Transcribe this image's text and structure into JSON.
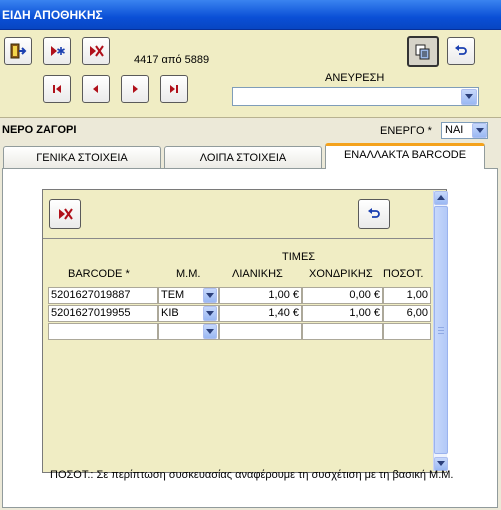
{
  "window": {
    "title": "ΕΙΔΗ ΑΠΟΘΗΚΗΣ"
  },
  "toolbar": {
    "record_position": "4417 από 5889",
    "search_label": "ΑΝΕΥΡΕΣΗ",
    "search_value": ""
  },
  "product": {
    "name": "ΝΕΡΟ ΖΑΓΟΡΙ",
    "active_label": "ΕΝΕΡΓΟ *",
    "active_value": "ΝΑΙ"
  },
  "tabs": [
    {
      "label": "ΓΕΝΙΚΑ ΣΤΟΙΧΕΙΑ",
      "active": false
    },
    {
      "label": "ΛΟΙΠΑ ΣΤΟΙΧΕΙΑ",
      "active": false
    },
    {
      "label": "ΕΝΑΛΛΑΚΤΑ BARCODE",
      "active": true
    }
  ],
  "grid": {
    "prices_group": "ΤΙΜΕΣ",
    "columns": {
      "barcode": "BARCODE *",
      "unit": "Μ.Μ.",
      "retail": "ΛΙΑΝΙΚΗΣ",
      "wholesale": "ΧΟΝΔΡΙΚΗΣ",
      "qty": "ΠΟΣΟΤ."
    },
    "rows": [
      {
        "barcode": "5201627019887",
        "unit": "TEM",
        "retail": "1,00 €",
        "wholesale": "0,00 €",
        "qty": "1,00"
      },
      {
        "barcode": "5201627019955",
        "unit": "ΚΙΒ",
        "retail": "1,40 €",
        "wholesale": "1,00 €",
        "qty": "6,00"
      }
    ]
  },
  "footnote": "ΠΟΣΟΤ.: Σε περίπτωση συσκευασίας αναφέρουμε τη συσχέτιση με τη βασική Μ.Μ.",
  "colors": {
    "title_blue": "#0a4fd6",
    "panel": "#F0EDC4",
    "nav_red": "#b0101a",
    "tab_accent": "#f4a21c"
  },
  "icons": [
    "exit-icon",
    "new-record-icon",
    "delete-record-icon",
    "first-record-icon",
    "previous-record-icon",
    "next-record-icon",
    "last-record-icon",
    "copy-icon",
    "undo-icon",
    "dropdown-arrow-icon"
  ]
}
